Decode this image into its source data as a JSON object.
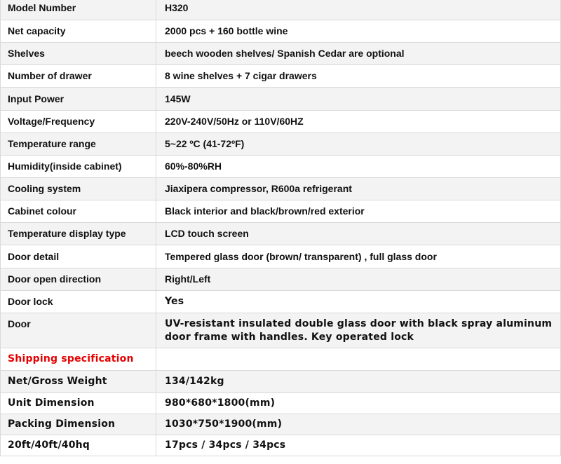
{
  "rows": [
    {
      "label": "Model Number",
      "value": "H320"
    },
    {
      "label": "Net capacity",
      "value": "2000 pcs + 160 bottle wine"
    },
    {
      "label": "Shelves",
      "value": "beech wooden shelves/ Spanish Cedar are optional"
    },
    {
      "label": "Number of drawer",
      "value": "8 wine shelves + 7 cigar drawers"
    },
    {
      "label": "Input Power",
      "value": "145W"
    },
    {
      "label": "Voltage/Frequency",
      "value": "220V-240V/50Hz  or  110V/60HZ"
    },
    {
      "label": "Temperature range",
      "value": " 5~22 ºC  (41-72ºF)"
    },
    {
      "label": "Humidity(inside cabinet)",
      "value": "60%-80%RH"
    },
    {
      "label": "Cooling system",
      "value": "Jiaxipera compressor, R600a refrigerant"
    },
    {
      "label": "Cabinet colour",
      "value": "Black interior and black/brown/red exterior"
    },
    {
      "label": "Temperature display type",
      "value": "LCD touch screen"
    },
    {
      "label": "Door detail",
      "value": "Tempered glass door  (brown/ transparent) , full glass door"
    },
    {
      "label": "Door open direction",
      "value": "Right/Left"
    },
    {
      "label": "Door lock",
      "value": "Yes"
    },
    {
      "label": "Door",
      "value": "UV-resistant insulated double glass door with black spray aluminum door frame with handles. Key operated lock"
    },
    {
      "label": "Shipping specification",
      "value": ""
    },
    {
      "label": "Net/Gross Weight",
      "value": "134/142kg"
    },
    {
      "label": "Unit Dimension",
      "value": "980*680*1800(mm)"
    },
    {
      "label": "Packing Dimension",
      "value": "1030*750*1900(mm)"
    },
    {
      "label": "20ft/40ft/40hq",
      "value": "17pcs / 34pcs / 34pcs"
    }
  ],
  "colors": {
    "heading": "#e60000",
    "border": "#d9d9d9",
    "alt_row": "#f3f3f3"
  }
}
